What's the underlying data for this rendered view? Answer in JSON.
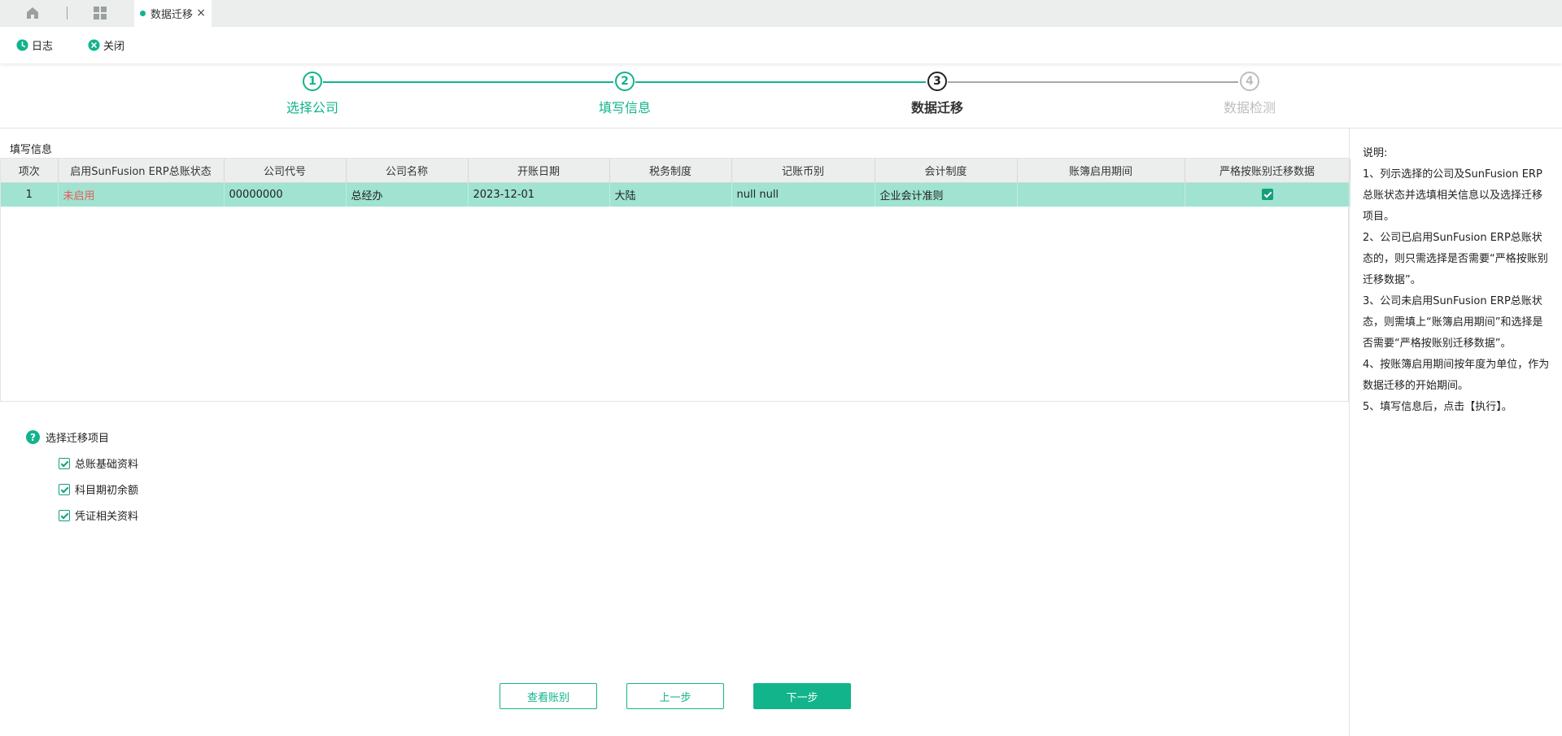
{
  "tabs": {
    "active_label": "数据迁移",
    "close_glyph": "×"
  },
  "toolbar": {
    "log_label": "日志",
    "close_label": "关闭"
  },
  "stepper": {
    "steps": [
      {
        "num": "1",
        "label": "选择公司",
        "state": "done"
      },
      {
        "num": "2",
        "label": "填写信息",
        "state": "done"
      },
      {
        "num": "3",
        "label": "数据迁移",
        "state": "current"
      },
      {
        "num": "4",
        "label": "数据检测",
        "state": "todo"
      }
    ]
  },
  "main": {
    "section_title": "填写信息",
    "table": {
      "headers": [
        "项次",
        "启用SunFusion ERP总账状态",
        "公司代号",
        "公司名称",
        "开账日期",
        "税务制度",
        "记账币别",
        "会计制度",
        "账簿启用期间",
        "严格按账别迁移数据"
      ],
      "rows": [
        {
          "index": "1",
          "status": "未启用",
          "code": "00000000",
          "name": "总经办",
          "open_date": "2023-12-01",
          "tax": "大陆",
          "currency": "null null",
          "accounting": "企业会计准则",
          "period": "",
          "strict": true
        }
      ]
    },
    "items_title": "选择迁移项目",
    "items": [
      {
        "label": "总账基础资料",
        "checked": true
      },
      {
        "label": "科目期初余额",
        "checked": true
      },
      {
        "label": "凭证相关资料",
        "checked": true
      }
    ],
    "buttons": {
      "view_books": "查看账别",
      "prev": "上一步",
      "next": "下一步"
    }
  },
  "notes": {
    "title": "说明:",
    "lines": [
      "1、列示选择的公司及SunFusion ERP总账状态并选填相关信息以及选择迁移项目。",
      "2、公司已启用SunFusion ERP总账状态的，则只需选择是否需要“严格按账别迁移数据”。",
      "3、公司未启用SunFusion ERP总账状态，则需填上“账簿启用期间”和选择是否需要“严格按账别迁移数据”。",
      "4、按账簿启用期间按年度为单位，作为数据迁移的开始期间。",
      "5、填写信息后，点击【执行】。"
    ]
  },
  "colors": {
    "accent": "#12b48b",
    "row_selected": "#9fe3d0",
    "status_inactive": "#e85a5a"
  },
  "icons": [
    "home-icon",
    "apps-grid-icon",
    "clock-icon",
    "close-circle-icon",
    "help-icon",
    "checkbox-icon"
  ]
}
